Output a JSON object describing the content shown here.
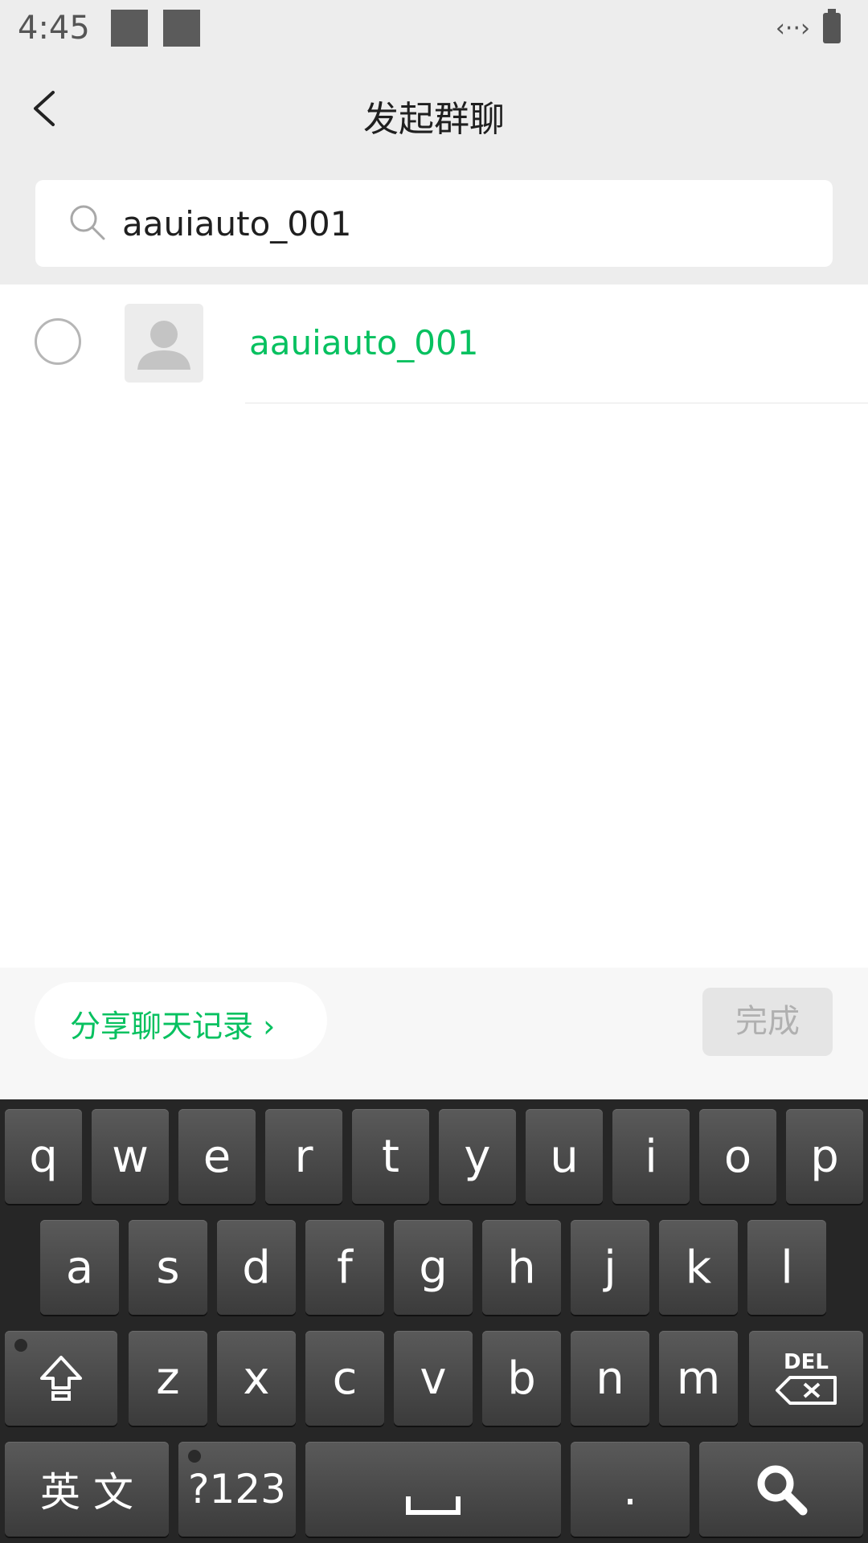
{
  "status_bar": {
    "time": "4:45",
    "network_icon": "data-transfer-icon",
    "battery_icon": "battery-icon"
  },
  "header": {
    "title": "发起群聊",
    "back_icon": "back-chevron-icon"
  },
  "search": {
    "value": "aauiauto_001",
    "icon": "search-icon"
  },
  "results": [
    {
      "name": "aauiauto_001",
      "avatar": "default-avatar-icon",
      "selected": false
    }
  ],
  "actions": {
    "share_label": "分享聊天记录 ›",
    "done_label": "完成"
  },
  "keyboard": {
    "row1": [
      "q",
      "w",
      "e",
      "r",
      "t",
      "y",
      "u",
      "i",
      "o",
      "p"
    ],
    "row2": [
      "a",
      "s",
      "d",
      "f",
      "g",
      "h",
      "j",
      "k",
      "l"
    ],
    "row3": [
      "z",
      "x",
      "c",
      "v",
      "b",
      "n",
      "m"
    ],
    "lang_label": "英 文",
    "symbols_label": "?123",
    "period_label": ".",
    "del_label": "DEL",
    "shift_icon": "shift-icon",
    "space_icon": "space-icon",
    "search_key_icon": "search-icon"
  },
  "colors": {
    "accent_green": "#07c160",
    "background": "#ededed",
    "keyboard_bg": "#262626"
  }
}
